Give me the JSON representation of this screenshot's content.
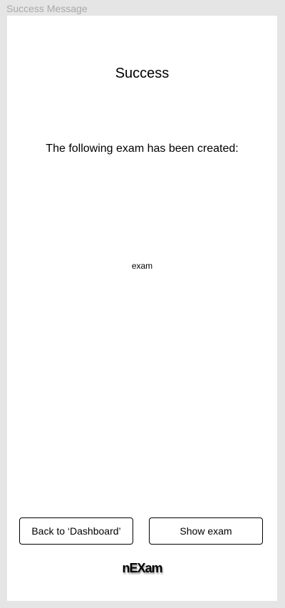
{
  "frame": {
    "label": "Success Message"
  },
  "screen": {
    "title": "Success",
    "message": "The following exam has been created:",
    "exam_name": "exam"
  },
  "actions": {
    "back_label": "Back to ‘Dashboard’",
    "show_label": "Show exam"
  },
  "brand": {
    "logo_text": "nEXam"
  },
  "colors": {
    "background": "#e5e5e5",
    "screen": "#ffffff",
    "text": "#000000",
    "frame_label": "#a9a9a9"
  }
}
